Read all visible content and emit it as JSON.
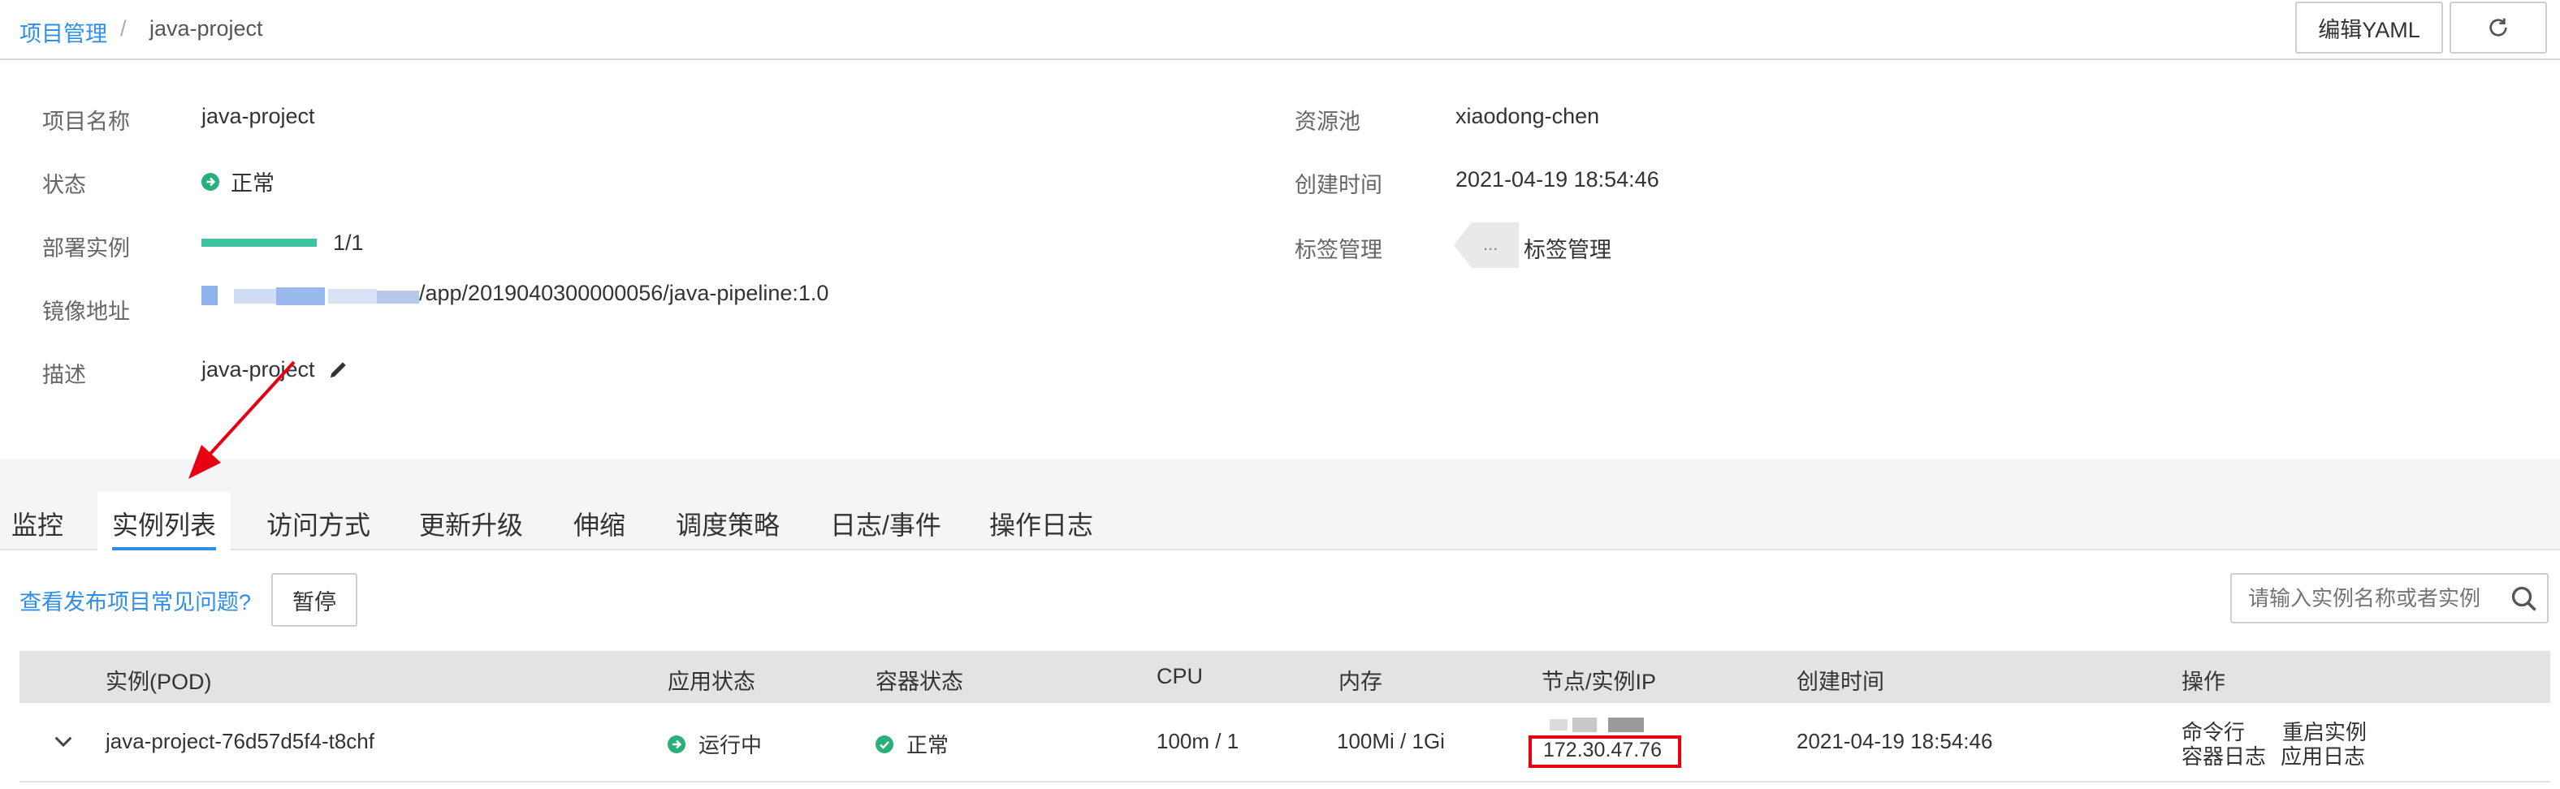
{
  "breadcrumb": {
    "root": "项目管理",
    "separator": "/",
    "current": "java-project"
  },
  "header": {
    "edit_yaml": "编辑YAML"
  },
  "info": {
    "name_label": "项目名称",
    "name_value": "java-project",
    "status_label": "状态",
    "status_value": "正常",
    "deploy_label": "部署实例",
    "deploy_value": "1/1",
    "deploy_progress": 1.0,
    "image_label": "镜像地址",
    "image_value": "/app/2019040300000056/java-pipeline:1.0",
    "desc_label": "描述",
    "desc_value": "java-project",
    "pool_label": "资源池",
    "pool_value": "xiaodong-chen",
    "created_label": "创建时间",
    "created_value": "2021-04-19 18:54:46",
    "tag_label": "标签管理",
    "tag_placeholder": "...",
    "tag_link": "标签管理"
  },
  "tabs": [
    {
      "label": "监控",
      "active": false
    },
    {
      "label": "实例列表",
      "active": true
    },
    {
      "label": "访问方式",
      "active": false
    },
    {
      "label": "更新升级",
      "active": false
    },
    {
      "label": "伸缩",
      "active": false
    },
    {
      "label": "调度策略",
      "active": false
    },
    {
      "label": "日志/事件",
      "active": false
    },
    {
      "label": "操作日志",
      "active": false
    }
  ],
  "toolbar": {
    "faq_link": "查看发布项目常见问题?",
    "pause_button": "暂停",
    "search_placeholder": "请输入实例名称或者实例"
  },
  "table": {
    "headers": [
      "实例(POD)",
      "应用状态",
      "容器状态",
      "CPU",
      "内存",
      "节点/实例IP",
      "创建时间",
      "操作"
    ],
    "rows": [
      {
        "pod": "java-project-76d57d5f4-t8chf",
        "app_status": "运行中",
        "container_status": "正常",
        "cpu": "100m / 1",
        "memory": "100Mi / 1Gi",
        "ip": "172.30.47.76",
        "created": "2021-04-19 18:54:46",
        "actions": {
          "cmd": "命令行",
          "restart": "重启实例",
          "container_log": "容器日志",
          "app_log": "应用日志"
        }
      }
    ]
  },
  "colors": {
    "accent": "#2f8ee8",
    "success": "#29b07a",
    "progress": "#3cc4a0",
    "highlight_border": "#e60012",
    "annotation_arrow": "#e60012"
  }
}
